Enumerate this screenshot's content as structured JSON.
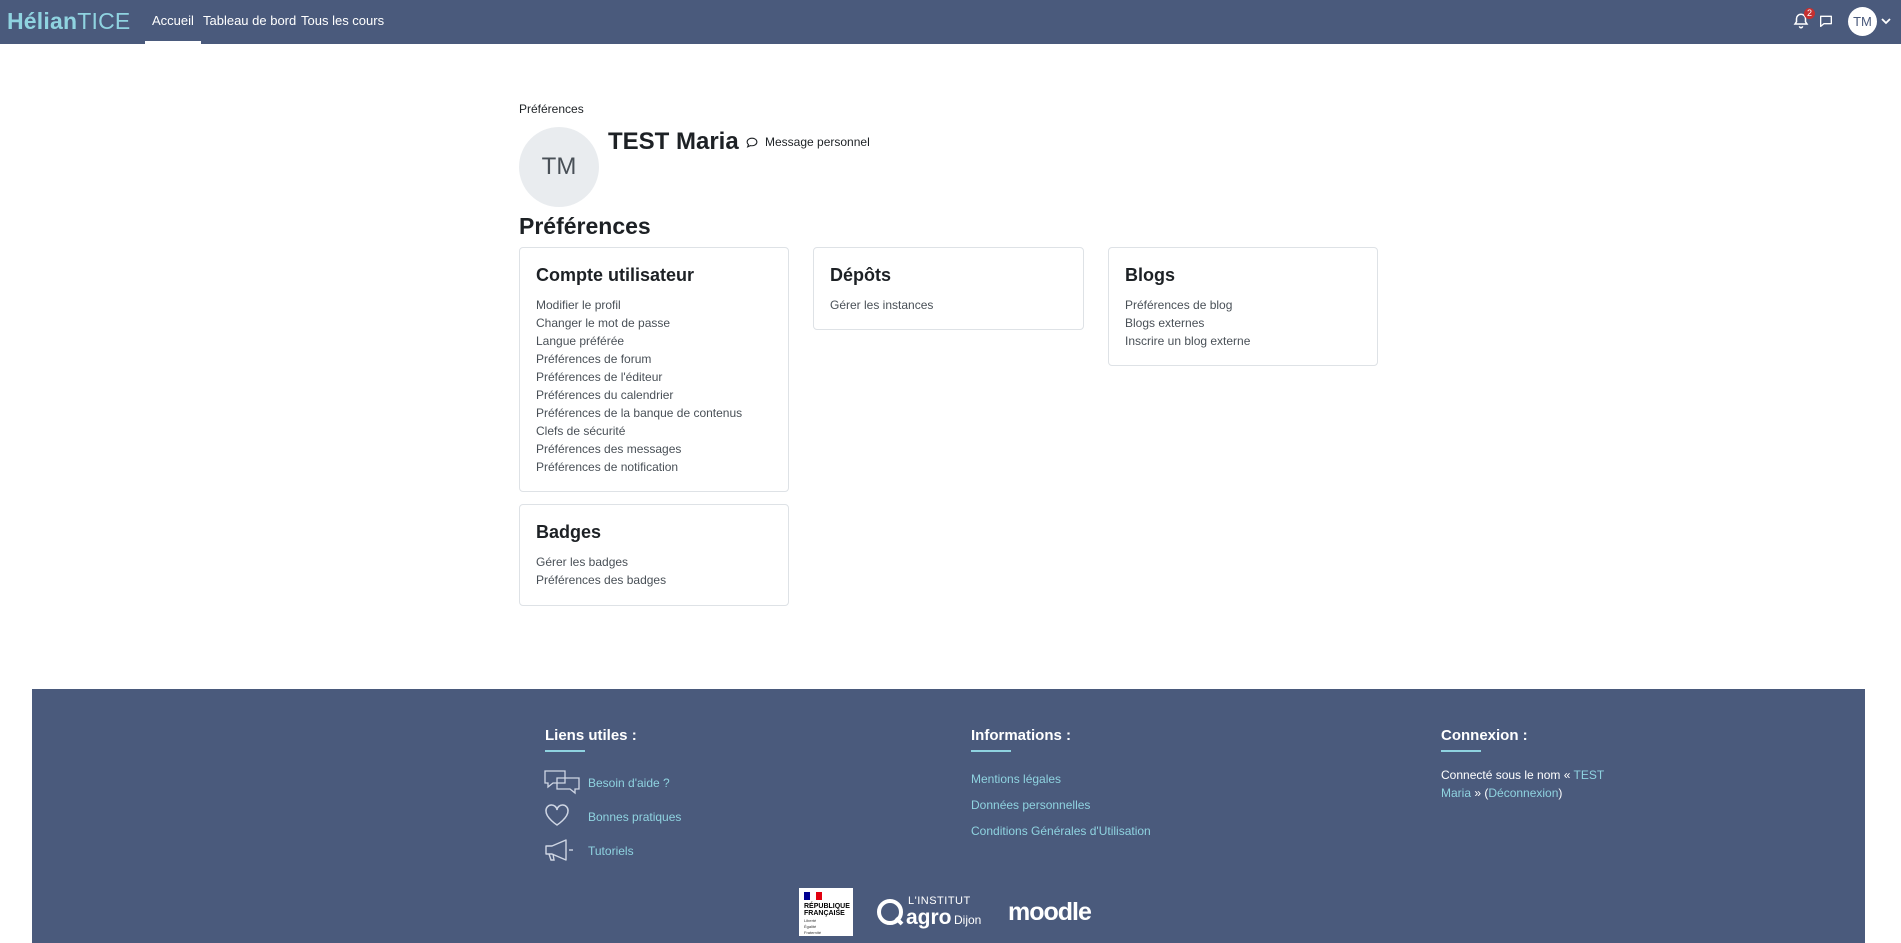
{
  "navbar": {
    "brand_part1": "Hélian",
    "brand_part2": "TICE",
    "links": [
      "Accueil",
      "Tableau de bord",
      "Tous les cours"
    ],
    "notification_count": "2",
    "user_initials": "TM",
    "icons": [
      "bell-icon",
      "chat-bubble-icon",
      "chevron-down-icon"
    ]
  },
  "header": {
    "breadcrumb": "Préférences",
    "avatar_initials": "TM",
    "user_name": "TEST Maria",
    "message_link": "Message personnel"
  },
  "page_title": "Préférences",
  "cards": {
    "account": {
      "title": "Compte utilisateur",
      "links": [
        "Modifier le profil",
        "Changer le mot de passe",
        "Langue préférée",
        "Préférences de forum",
        "Préférences de l'éditeur",
        "Préférences du calendrier",
        "Préférences de la banque de contenus",
        "Clefs de sécurité",
        "Préférences des messages",
        "Préférences de notification"
      ]
    },
    "repositories": {
      "title": "Dépôts",
      "links": [
        "Gérer les instances"
      ]
    },
    "blogs": {
      "title": "Blogs",
      "links": [
        "Préférences de blog",
        "Blogs externes",
        "Inscrire un blog externe"
      ]
    },
    "badges": {
      "title": "Badges",
      "links": [
        "Gérer les badges",
        "Préférences des badges"
      ]
    }
  },
  "footer": {
    "useful_links": {
      "title": "Liens utiles :",
      "items": [
        "Besoin d'aide ?",
        "Bonnes pratiques",
        "Tutoriels"
      ]
    },
    "information": {
      "title": "Informations :",
      "items": [
        "Mentions légales",
        "Données personnelles",
        "Conditions Générales d'Utilisation"
      ]
    },
    "connection": {
      "title": "Connexion :",
      "prefix": "Connecté sous le nom « ",
      "user_link": "TEST Maria",
      "middle": " » (",
      "logout_link": "Déconnexion",
      "suffix": ")"
    },
    "logos": {
      "rf_line1": "RÉPUBLIQUE",
      "rf_line2": "FRANÇAISE",
      "rf_motto": [
        "Liberté",
        "Égalité",
        "Fraternité"
      ],
      "agro_line1": "L'INSTITUT",
      "agro_line2": "agro",
      "agro_line3": "Dijon",
      "moodle": "moodle"
    }
  },
  "colors": {
    "navbar_bg": "#4a5a7c",
    "brand_accent": "#8fd3e0",
    "footer_bg": "#4a5a7c",
    "card_border": "#dee2e6"
  }
}
